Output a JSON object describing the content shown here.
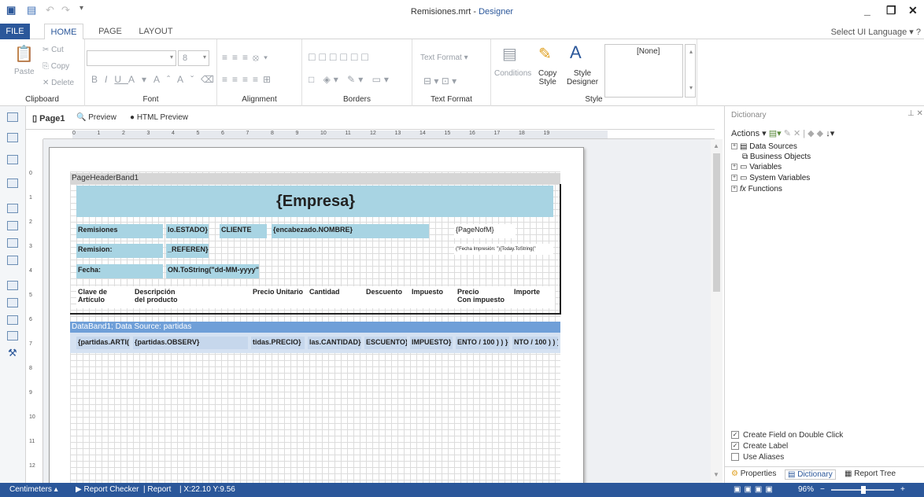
{
  "window": {
    "title": "Remisiones.mrt",
    "title_suffix": "Designer"
  },
  "ribbon_tabs": [
    "FILE",
    "HOME",
    "PAGE",
    "LAYOUT"
  ],
  "language": "Select UI Language",
  "clipboard": {
    "paste": "Paste",
    "cut": "Cut",
    "copy": "Copy",
    "delete": "Delete",
    "label": "Clipboard"
  },
  "font": {
    "size": "8",
    "label": "Font"
  },
  "alignment": {
    "label": "Alignment"
  },
  "borders": {
    "label": "Borders"
  },
  "textformat": {
    "combo": "Text Format",
    "label": "Text Format"
  },
  "style": {
    "conditions": "Conditions",
    "copy_style_1": "Copy",
    "copy_style_2": "Style",
    "style_designer_1": "Style",
    "style_designer_2": "Designer",
    "none": "[None]",
    "label": "Style"
  },
  "doc_tabs": [
    "Page1",
    "Preview",
    "HTML Preview"
  ],
  "hruler": [
    "0",
    "1",
    "2",
    "3",
    "4",
    "5",
    "6",
    "7",
    "8",
    "9",
    "10",
    "11",
    "12",
    "13",
    "14",
    "15",
    "16",
    "17",
    "18",
    "19"
  ],
  "vruler": [
    "0",
    "1",
    "2",
    "3",
    "4",
    "5",
    "6",
    "7",
    "8",
    "9",
    "10",
    "11",
    "12"
  ],
  "bands": {
    "header": "PageHeaderBand1",
    "data": "DataBand1; Data Source: partidas",
    "empresa": "{Empresa}",
    "row1": [
      "Remisiones",
      "lo.ESTADO}",
      "CLIENTE",
      "{encabezado.NOMBRE}",
      "{PageNofM}"
    ],
    "row2": [
      "Remision:",
      "_REFEREN}",
      "(\"Fecha Impresión: \"){Today.ToString(\""
    ],
    "row3": [
      "Fecha:",
      "ON.ToString(\"dd-MM-yyyy\")}"
    ],
    "cols": [
      "Clave de",
      "Artículo",
      "Descripción",
      "del producto",
      "Precio Unitario",
      "Cantidad",
      "Descuento",
      "Impuesto",
      "Precio",
      "Con impuesto",
      "Importe"
    ],
    "datacells": [
      "{partidas.ARTI(",
      "{partidas.OBSERV}",
      "tidas.PRECIO}",
      "las.CANTIDAD}",
      "ESCUENTO}",
      "IMPUESTO}",
      "ENTO / 100 ) ) }",
      "NTO / 100 ) ) }"
    ]
  },
  "dictionary": {
    "title": "Dictionary",
    "actions": "Actions",
    "tree": [
      "Data Sources",
      "Business Objects",
      "Variables",
      "System Variables",
      "Functions"
    ],
    "checks": [
      {
        "label": "Create Field on Double Click",
        "checked": true
      },
      {
        "label": "Create Label",
        "checked": true
      },
      {
        "label": "Use Aliases",
        "checked": false
      }
    ],
    "tabs": [
      "Properties",
      "Dictionary",
      "Report Tree"
    ]
  },
  "status": {
    "units": "Centimeters",
    "checker": "Report Checker",
    "report": "Report",
    "coords": "X:22.10  Y:9.56",
    "zoom": "96%"
  }
}
